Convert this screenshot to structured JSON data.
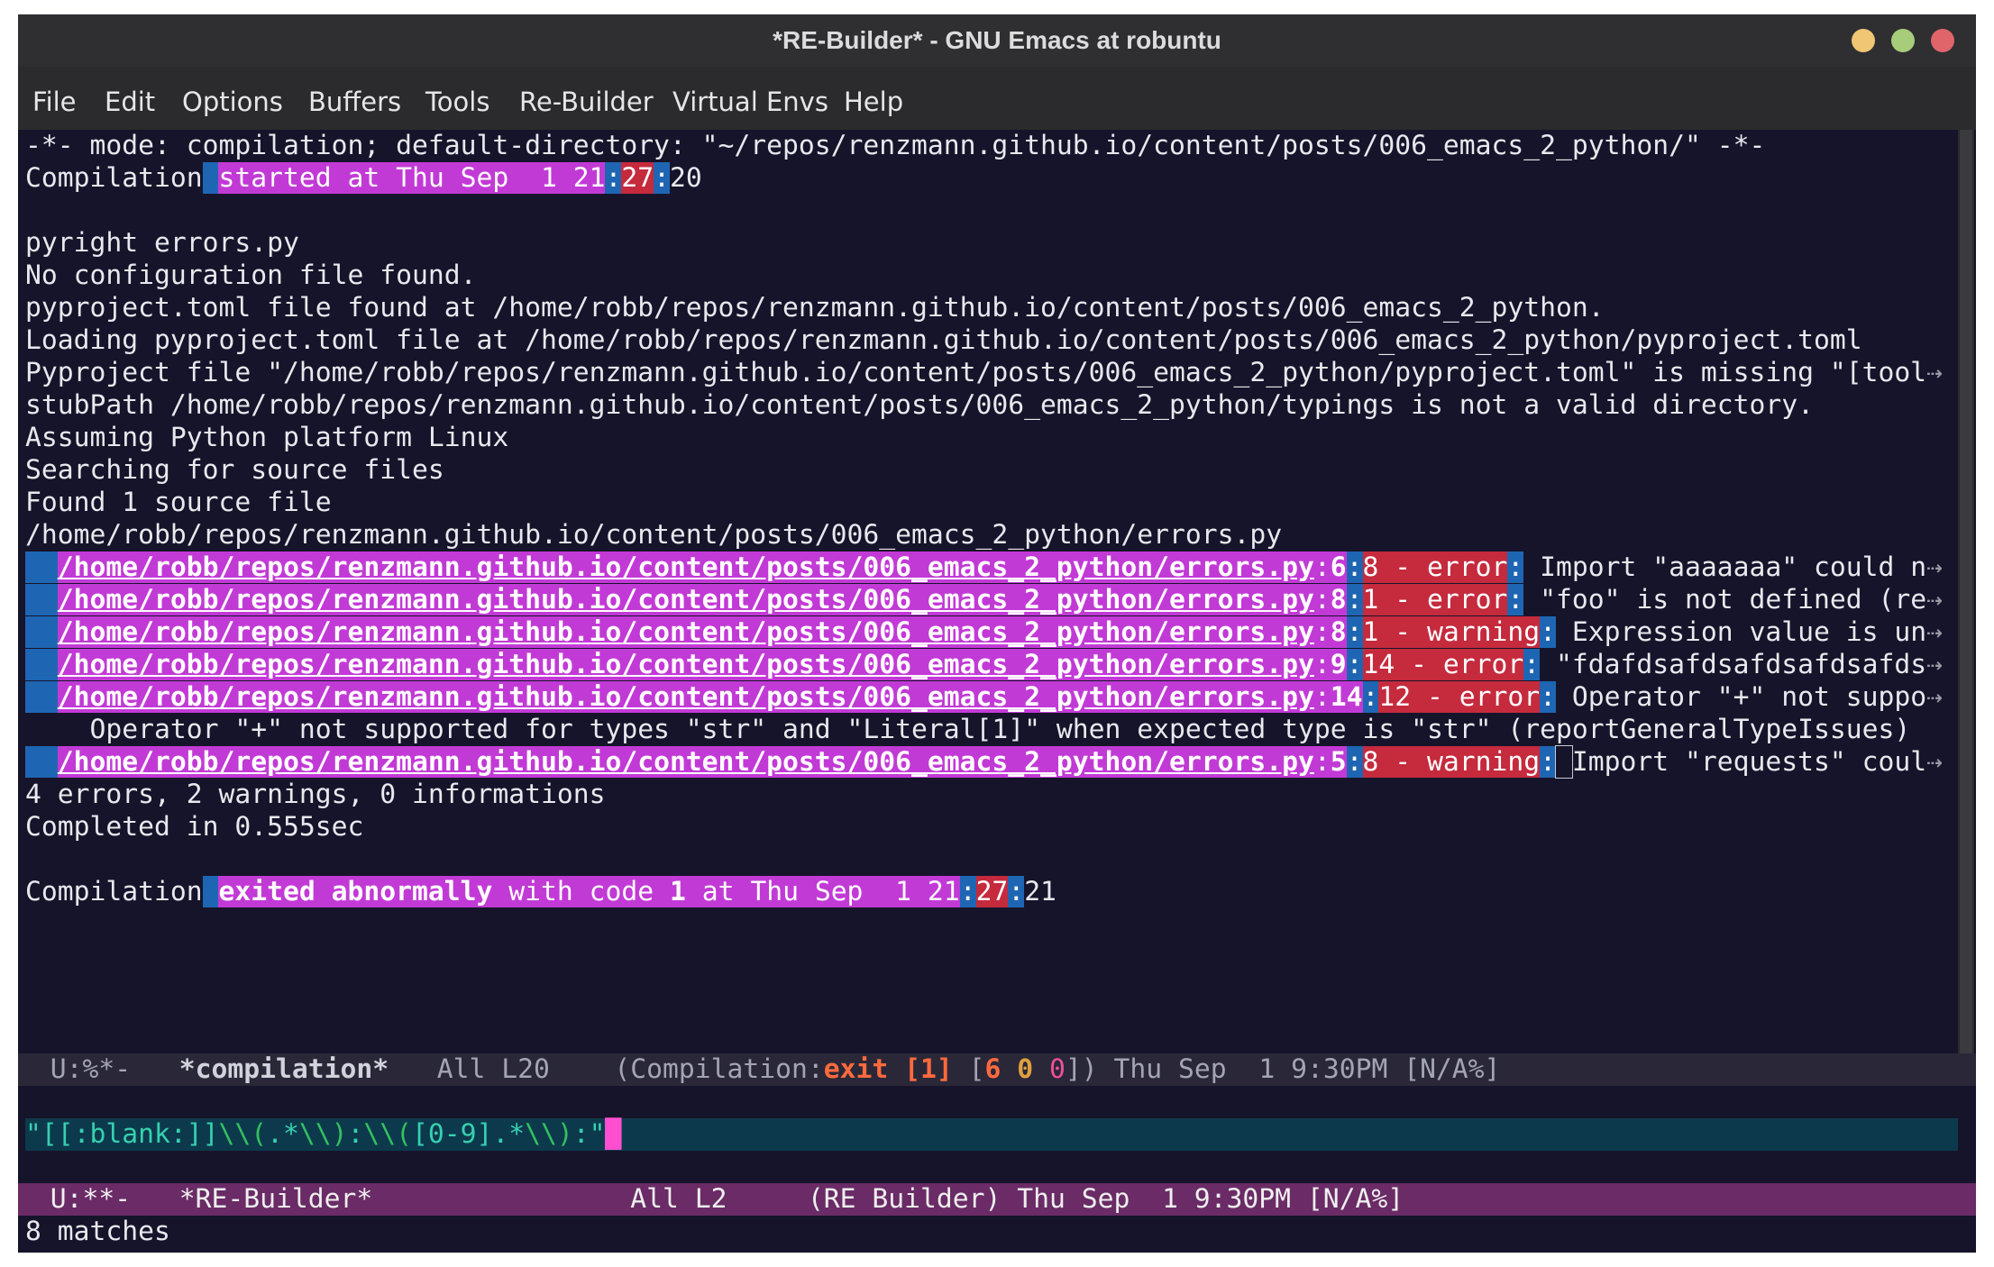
{
  "window": {
    "title": "*RE-Builder* - GNU Emacs at robuntu"
  },
  "menu": [
    "File",
    "Edit",
    "Options",
    "Buffers",
    "Tools",
    "Re-Builder",
    "Virtual Envs",
    "Help"
  ],
  "buffer": {
    "header_line": "-*- mode: compilation; default-directory: \"~/repos/renzmann.github.io/content/posts/006_emacs_2_python/\" -*-",
    "started": {
      "prefix": "Compilation",
      "text": "started at Thu Sep  1 21",
      "minute": "27",
      "second": "20"
    },
    "log_lines": [
      "pyright errors.py",
      "No configuration file found.",
      "pyproject.toml file found at /home/robb/repos/renzmann.github.io/content/posts/006_emacs_2_python.",
      "Loading pyproject.toml file at /home/robb/repos/renzmann.github.io/content/posts/006_emacs_2_python/pyproject.toml",
      "Pyproject file \"/home/robb/repos/renzmann.github.io/content/posts/006_emacs_2_python/pyproject.toml\" is missing \"[tool",
      "stubPath /home/robb/repos/renzmann.github.io/content/posts/006_emacs_2_python/typings is not a valid directory.",
      "Assuming Python platform Linux",
      "Searching for source files",
      "Found 1 source file",
      "/home/robb/repos/renzmann.github.io/content/posts/006_emacs_2_python/errors.py"
    ],
    "matches": [
      {
        "path": "/home/robb/repos/renzmann.github.io/content/posts/006_emacs_2_python/errors.py",
        "line": "6",
        "pos": "8 - error",
        "message": " Import \"aaaaaaa\" could n"
      },
      {
        "path": "/home/robb/repos/renzmann.github.io/content/posts/006_emacs_2_python/errors.py",
        "line": "8",
        "pos": "1 - error",
        "message": " \"foo\" is not defined (re"
      },
      {
        "path": "/home/robb/repos/renzmann.github.io/content/posts/006_emacs_2_python/errors.py",
        "line": "8",
        "pos": "1 - warning",
        "message": " Expression value is un"
      },
      {
        "path": "/home/robb/repos/renzmann.github.io/content/posts/006_emacs_2_python/errors.py",
        "line": "9",
        "pos": "14 - error",
        "message": " \"fdafdsafdsafdsafdsafds"
      },
      {
        "path": "/home/robb/repos/renzmann.github.io/content/posts/006_emacs_2_python/errors.py",
        "line": "14",
        "pos": "12 - error",
        "message": " Operator \"+\" not suppo"
      }
    ],
    "operator_line": "    Operator \"+\" not supported for types \"str\" and \"Literal[1]\" when expected type is \"str\" (reportGeneralTypeIssues)",
    "last_match": {
      "path": "/home/robb/repos/renzmann.github.io/content/posts/006_emacs_2_python/errors.py",
      "line": "5",
      "pos": "8 - warning",
      "message": "Import \"requests\" coul"
    },
    "summary": "4 errors, 2 warnings, 0 informations",
    "completed": "Completed in 0.555sec",
    "exited": {
      "prefix": "Compilation",
      "bold": "exited abnormally",
      "mid": " with code ",
      "code": "1",
      "tail": " at Thu Sep  1 21",
      "minute": "27",
      "second": "21"
    }
  },
  "modeline_compilation": {
    "state": "U:%*-",
    "buffer_name": "*compilation*",
    "position": "All L20",
    "mode_open": "(Compilation",
    "exit": "exit",
    "exit_code": "[1]",
    "counts": [
      "6",
      "0",
      "0"
    ],
    "time": "Thu Sep  1 9:30PM [N/A%]"
  },
  "regexp": {
    "q1": "\"",
    "blank": "[[:blank:]]",
    "grp_open": "\\\\(",
    "any": ".*",
    "grp_close": "\\\\)",
    "colon": ":",
    "range": "[0-9]",
    "q2": "\""
  },
  "modeline_rebuilder": {
    "state": "U:**-",
    "buffer_name": "*RE-Builder*",
    "position": "All L2",
    "mode": "(RE Builder)",
    "time": "Thu Sep  1 9:30PM [N/A%]"
  },
  "echo_area": "8 matches",
  "colors": {
    "background": "#16142a",
    "match_magenta": "#c23ad6",
    "match_blue": "#1e66b3",
    "match_red": "#c52a3d",
    "modeline_active": "#6a2b66",
    "rebuilder_bg": "#0c3a4c"
  }
}
